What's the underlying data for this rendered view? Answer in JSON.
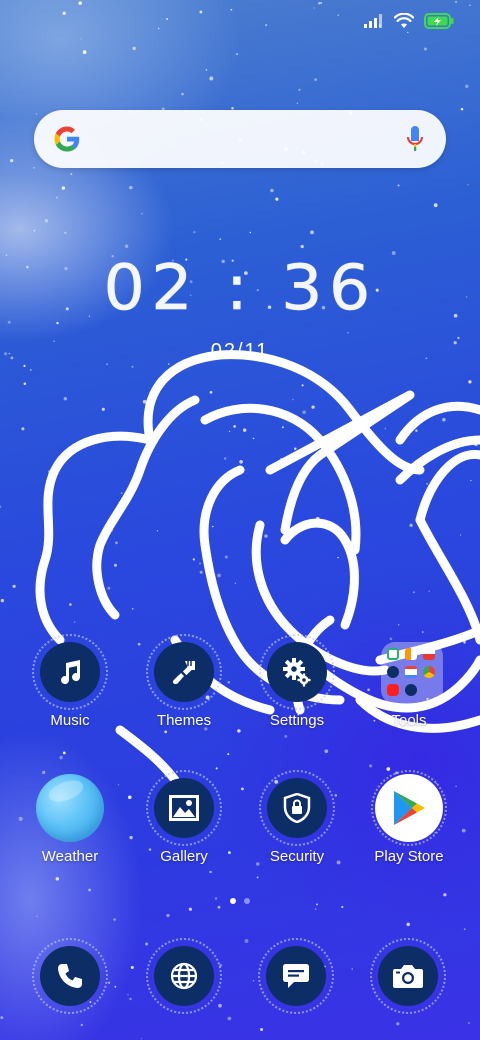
{
  "status_bar": {
    "icons": [
      "signal-icon",
      "wifi-icon",
      "battery-charging-icon"
    ],
    "battery_color": "#3ddc4a"
  },
  "search_bar": {
    "logo": "google-g-icon",
    "mic": "microphone-icon"
  },
  "clock": {
    "time": "02 : 36",
    "date": "02/11"
  },
  "apps_row1": [
    {
      "label": "Music",
      "icon": "music-note-icon"
    },
    {
      "label": "Themes",
      "icon": "paintbrush-icon"
    },
    {
      "label": "Settings",
      "icon": "gears-icon"
    },
    {
      "label": "Tools",
      "icon": "folder-icon"
    }
  ],
  "apps_row2": [
    {
      "label": "Weather",
      "icon": "weather-orb-icon"
    },
    {
      "label": "Gallery",
      "icon": "image-icon"
    },
    {
      "label": "Security",
      "icon": "shield-lock-icon"
    },
    {
      "label": "Play Store",
      "icon": "play-store-icon"
    }
  ],
  "page_indicator": {
    "pages": 2,
    "current": 1
  },
  "dock": [
    {
      "icon": "phone-icon"
    },
    {
      "icon": "globe-icon"
    },
    {
      "icon": "message-icon"
    },
    {
      "icon": "camera-icon"
    }
  ],
  "colors": {
    "icon_circle": "#0d2d67",
    "wallpaper_blue": "#2c3ce0",
    "accent_white": "#ffffff"
  }
}
